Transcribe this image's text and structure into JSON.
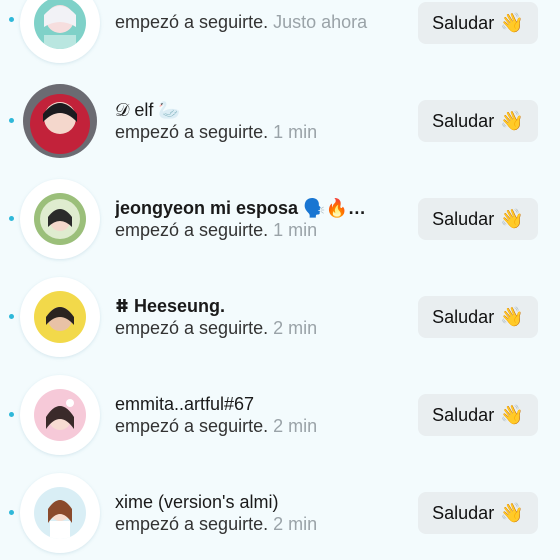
{
  "button_label": "Saludar",
  "wave_emoji": "👋",
  "activity_text": "empezó a seguirte.",
  "rows": [
    {
      "name": "",
      "time": "Justo ahora"
    },
    {
      "name": "𝒟 elf 🦢",
      "time": "1 min"
    },
    {
      "name": "jeongyeon mi esposa 🗣️🔥…",
      "time": "1 min"
    },
    {
      "name": "ⵌ Heeseung.",
      "time": "2 min"
    },
    {
      "name": "emmita..artful#67",
      "time": "2 min"
    },
    {
      "name": "xime (version's almi)",
      "time": "2 min"
    }
  ],
  "colors": {
    "background": "#f3fbfd",
    "unread_dot": "#2fb8d9",
    "button_bg": "#e9eef0",
    "time_text": "#9aa3a8"
  }
}
